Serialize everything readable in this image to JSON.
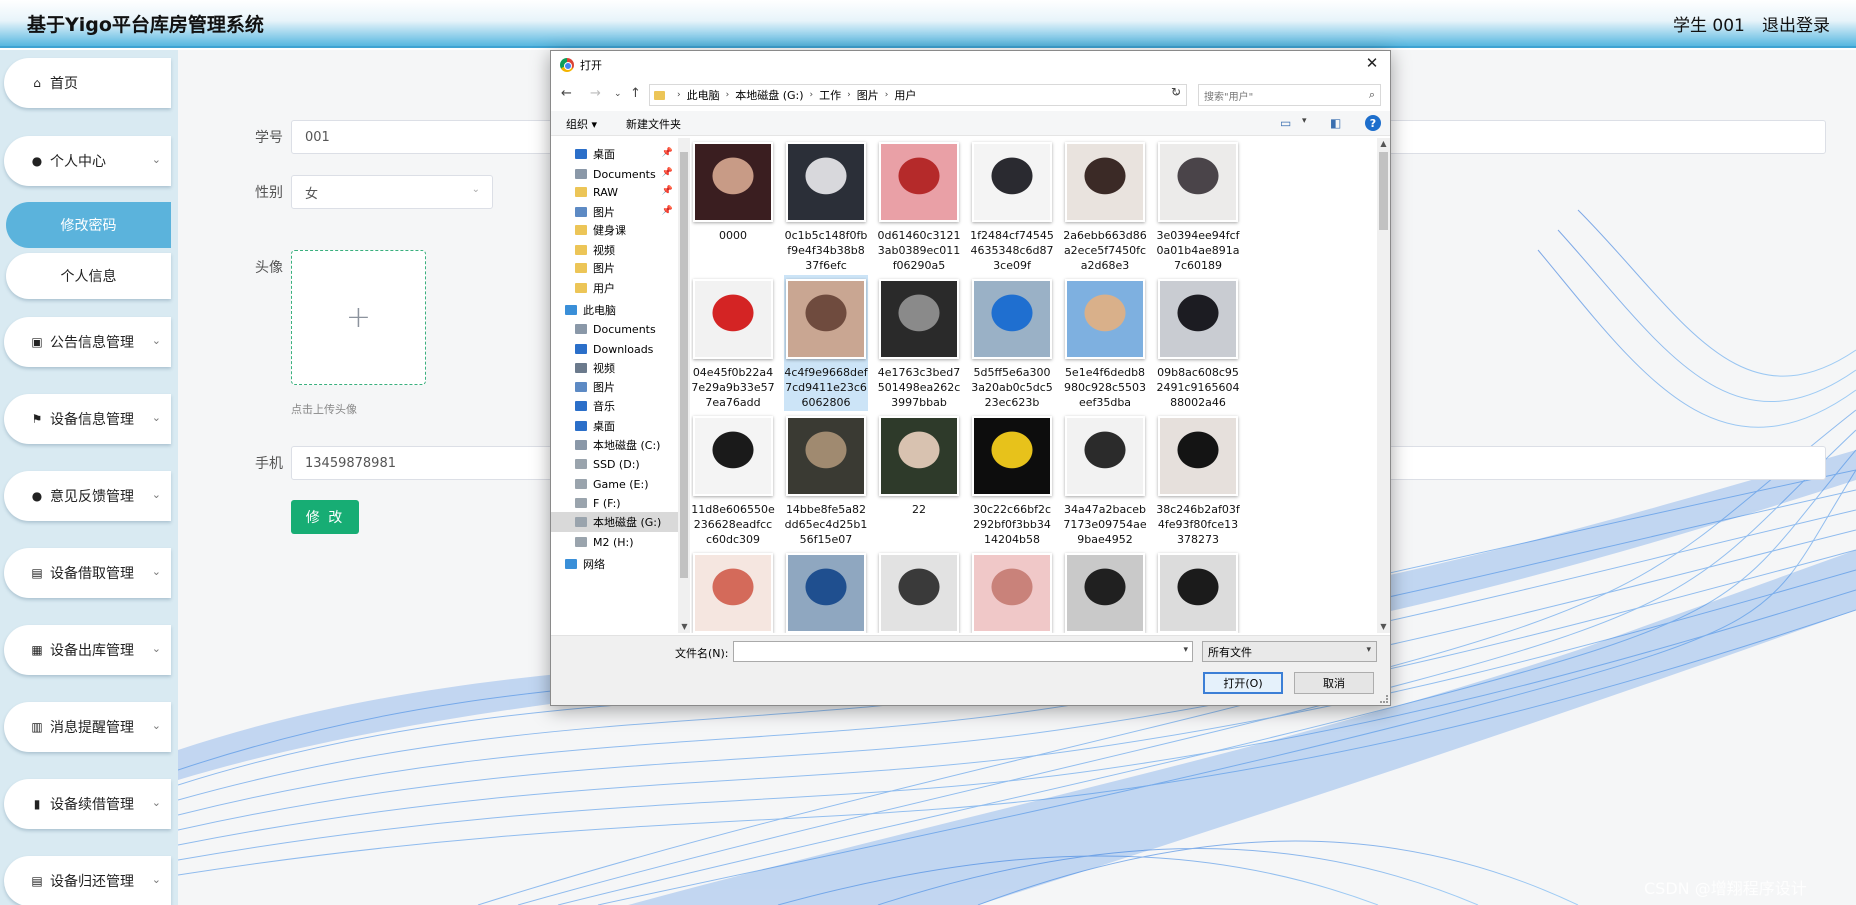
{
  "header": {
    "title": "基于Yigo平台库房管理系统",
    "user": "学生 001",
    "logout": "退出登录"
  },
  "sidebar": {
    "items": [
      {
        "label": "首页",
        "icon": "home-icon"
      },
      {
        "label": "个人中心",
        "icon": "user-icon"
      },
      {
        "label": "修改密码",
        "icon": ""
      },
      {
        "label": "个人信息",
        "icon": ""
      },
      {
        "label": "公告信息管理",
        "icon": "chart-icon"
      },
      {
        "label": "设备信息管理",
        "icon": "flag-icon"
      },
      {
        "label": "意见反馈管理",
        "icon": "pin-icon"
      },
      {
        "label": "设备借取管理",
        "icon": "clipboard-icon"
      },
      {
        "label": "设备出库管理",
        "icon": "grid-icon"
      },
      {
        "label": "消息提醒管理",
        "icon": "calendar-icon"
      },
      {
        "label": "设备续借管理",
        "icon": "bar-chart-icon"
      },
      {
        "label": "设备归还管理",
        "icon": "clipboard-icon"
      }
    ]
  },
  "form": {
    "student_id_label": "学号",
    "student_id_value": "001",
    "gender_label": "性别",
    "gender_value": "女",
    "avatar_label": "头像",
    "upload_hint": "点击上传头像",
    "phone_label": "手机",
    "phone_value": "13459878981",
    "submit_label": "修 改"
  },
  "dialog": {
    "title": "打开",
    "close": "✕",
    "path": [
      "此电脑",
      "本地磁盘 (G:)",
      "工作",
      "图片",
      "用户"
    ],
    "search_placeholder": "搜索\"用户\"",
    "organize": "组织 ▾",
    "new_folder": "新建文件夹",
    "tree": [
      {
        "label": "桌面",
        "color": "#2b6fc9",
        "pinned": true
      },
      {
        "label": "Documents",
        "color": "#8a98a8",
        "pinned": true
      },
      {
        "label": "RAW",
        "color": "#ecc557",
        "pinned": true
      },
      {
        "label": "图片",
        "color": "#5d8ac4",
        "pinned": true
      },
      {
        "label": "健身课",
        "color": "#ecc557",
        "pinned": false
      },
      {
        "label": "视频",
        "color": "#ecc557",
        "pinned": false
      },
      {
        "label": "图片",
        "color": "#ecc557",
        "pinned": false
      },
      {
        "label": "用户",
        "color": "#ecc557",
        "pinned": false
      },
      {
        "label": "此电脑",
        "color": "#3a8fd8",
        "pinned": false
      },
      {
        "label": "Documents",
        "color": "#8a98a8",
        "pinned": false
      },
      {
        "label": "Downloads",
        "color": "#2b6fc9",
        "pinned": false
      },
      {
        "label": "视频",
        "color": "#6b7a8c",
        "pinned": false
      },
      {
        "label": "图片",
        "color": "#5d8ac4",
        "pinned": false
      },
      {
        "label": "音乐",
        "color": "#2b6fc9",
        "pinned": false
      },
      {
        "label": "桌面",
        "color": "#2b6fc9",
        "pinned": false
      },
      {
        "label": "本地磁盘 (C:)",
        "color": "#8a98a8",
        "pinned": false
      },
      {
        "label": "SSD (D:)",
        "color": "#9aa4ad",
        "pinned": false
      },
      {
        "label": "Game (E:)",
        "color": "#9aa4ad",
        "pinned": false
      },
      {
        "label": "F (F:)",
        "color": "#9aa4ad",
        "pinned": false
      },
      {
        "label": "本地磁盘 (G:)",
        "color": "#9aa4ad",
        "pinned": false
      },
      {
        "label": "M2 (H:)",
        "color": "#9aa4ad",
        "pinned": false
      },
      {
        "label": "网络",
        "color": "#3a8fd8",
        "pinned": false
      }
    ],
    "files": [
      {
        "name": "0000",
        "c1": "#3a1e20",
        "c2": "#c89b86"
      },
      {
        "name": "0c1b5c148f0fbf9e4f34b38b837f6efc",
        "c1": "#2b2f38",
        "c2": "#d8d8dc"
      },
      {
        "name": "0d61460c31213ab0389ec011f06290a5",
        "c1": "#e9a0a6",
        "c2": "#b52a2a"
      },
      {
        "name": "1f2484cf745454635348c6d873ce09f",
        "c1": "#f4f4f4",
        "c2": "#2a2a30"
      },
      {
        "name": "2a6ebb663d86a2ece5f7450fca2d68e3",
        "c1": "#e9e3de",
        "c2": "#3b2a26"
      },
      {
        "name": "3e0394ee94fcf0a01b4ae891a7c60189",
        "c1": "#ecebea",
        "c2": "#4a4449"
      },
      {
        "name": "04e45f0b22a47e29a9b33e577ea76add",
        "c1": "#f2f2f2",
        "c2": "#d42424"
      },
      {
        "name": "4c4f9e9668def7cd9411e23c66062806",
        "c1": "#c9a692",
        "c2": "#6f4b3e"
      },
      {
        "name": "4e1763c3bed7501498ea262c3997bbab",
        "c1": "#2a2a2a",
        "c2": "#8a8a8a"
      },
      {
        "name": "5d5ff5e6a3003a20ab0c5dc523ec623b",
        "c1": "#9ab1c6",
        "c2": "#1f6fd0"
      },
      {
        "name": "5e1e4f6dedb8980c928c5503eef35dba",
        "c1": "#7eb0e0",
        "c2": "#d9b08a"
      },
      {
        "name": "09b8ac608c952491c916560488002a46",
        "c1": "#c9ccd2",
        "c2": "#1c1c22"
      },
      {
        "name": "11d8e606550e236628eadfccc60dc309",
        "c1": "#f4f4f4",
        "c2": "#1a1a1a"
      },
      {
        "name": "14bbe8fe5a82dd65ec4d25b156f15e07",
        "c1": "#3a3a33",
        "c2": "#a08a70"
      },
      {
        "name": "22",
        "c1": "#2e3a2a",
        "c2": "#d8c2b0"
      },
      {
        "name": "30c22c66bf2c292bf0f3bb3414204b58",
        "c1": "#0d0d0d",
        "c2": "#e7c21b"
      },
      {
        "name": "34a47a2baceb7173e09754ae9bae4952",
        "c1": "#f2f2f2",
        "c2": "#2b2b2b"
      },
      {
        "name": "38c246b2af03f4fe93f80fce13378273",
        "c1": "#e6e0dc",
        "c2": "#141414"
      },
      {
        "name": "",
        "c1": "#f5e6e0",
        "c2": "#d46a5a"
      },
      {
        "name": "",
        "c1": "#8fa7c0",
        "c2": "#1f4f8f"
      },
      {
        "name": "",
        "c1": "#e2e2e2",
        "c2": "#3a3a3a"
      },
      {
        "name": "",
        "c1": "#f0c8c8",
        "c2": "#c9827a"
      },
      {
        "name": "",
        "c1": "#c9c9c9",
        "c2": "#202020"
      },
      {
        "name": "",
        "c1": "#dcdcdc",
        "c2": "#1b1b1b"
      }
    ],
    "filename_label": "文件名(N):",
    "filename_value": "",
    "filetype_value": "所有文件",
    "open_label": "打开(O)",
    "cancel_label": "取消"
  },
  "watermark": "CSDN @增翔程序设计"
}
